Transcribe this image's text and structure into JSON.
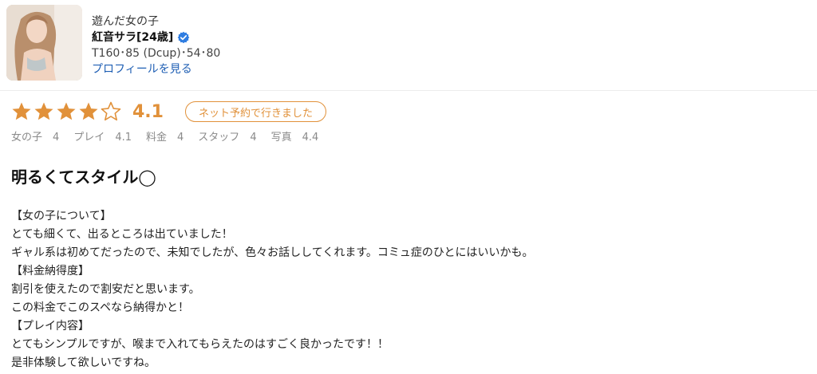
{
  "profile": {
    "section_label": "遊んだ女の子",
    "name": "紅音サラ[24歳]",
    "stats": "T160･85 (Dcup)･54･80",
    "profile_link": "プロフィールを見る"
  },
  "rating": {
    "stars": 4,
    "max_stars": 5,
    "score": "4.1",
    "badge": "ネット予約で行きました",
    "star_color": "#e1913a"
  },
  "subscores": [
    {
      "label": "女の子",
      "value": "4"
    },
    {
      "label": "プレイ",
      "value": "4.1"
    },
    {
      "label": "料金",
      "value": "4"
    },
    {
      "label": "スタッフ",
      "value": "4"
    },
    {
      "label": "写真",
      "value": "4.4"
    }
  ],
  "review": {
    "title": "明るくてスタイル◯",
    "lines": [
      "【女の子について】",
      "とても細くて、出るところは出ていました！",
      "ギャル系は初めてだったので、未知でしたが、色々お話ししてくれます。コミュ症のひとにはいいかも。",
      "【料金納得度】",
      "割引を使えたので割安だと思います。",
      "この料金でこのスペなら納得かと！",
      "【プレイ内容】",
      "とてもシンプルですが、喉まで入れてもらえたのはすごく良かったです！！",
      "是非体験して欲しいですね。"
    ]
  },
  "icons": {
    "verified": "verified-check-icon",
    "star_full": "star-filled-icon",
    "star_empty": "star-outline-icon"
  },
  "colors": {
    "accent": "#e1913a",
    "link": "#1f5fb4",
    "verified": "#2f7de1"
  }
}
